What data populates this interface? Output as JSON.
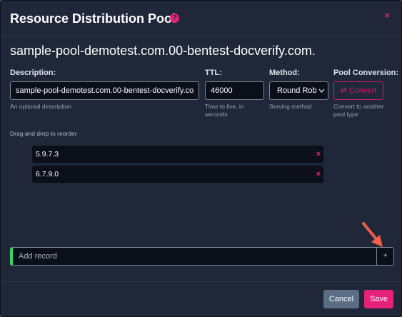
{
  "modal": {
    "title": "Resource Distribution Pool",
    "help_icon": "?",
    "close_icon": "×"
  },
  "pool": {
    "name": "sample-pool-demotest.com.00-bentest-docverify.com."
  },
  "fields": {
    "description": {
      "label": "Description:",
      "value": "sample-pool-demotest.com.00-bentest-docverify.co",
      "help": "An optional description"
    },
    "ttl": {
      "label": "TTL:",
      "value": "46000",
      "help": "Time to live, in seconds"
    },
    "method": {
      "label": "Method:",
      "value": "Round Rob",
      "help": "Serving method"
    },
    "conversion": {
      "label": "Pool Conversion:",
      "button": "⇄ Convert",
      "help": "Convert to another pool type"
    }
  },
  "records": {
    "hint": "Drag and drop to reorder",
    "items": [
      {
        "value": "5.9.7.3",
        "remove": "×"
      },
      {
        "value": "6.7.9.0",
        "remove": "×"
      }
    ]
  },
  "add_record": {
    "placeholder": "Add record",
    "button": "+"
  },
  "footer": {
    "cancel": "Cancel",
    "save": "Save"
  },
  "colors": {
    "accent": "#e6217a",
    "success": "#3cd26f",
    "annotation_arrow": "#f0604a"
  }
}
